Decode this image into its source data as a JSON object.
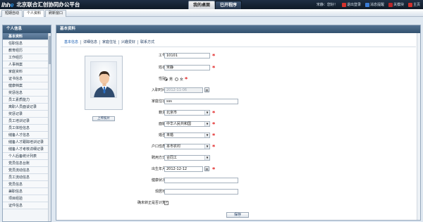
{
  "header": {
    "logo_text_1": "Ihh",
    "logo_text_2": "e",
    "title": "北京联合汇创协同办公平台",
    "tabs": [
      "我的桌面",
      "已开程序"
    ],
    "greeting": "宋静：您好！",
    "actions": [
      "退出登录",
      "消息提醒",
      "关模块",
      "主页"
    ]
  },
  "subtabs": [
    "短期自动",
    "个人资料",
    "刷新窗口"
  ],
  "sidebar": {
    "title": "个人信息",
    "items": [
      "基本资料",
      "任职信息",
      "教育经历",
      "工作经历",
      "人事档案",
      "家庭资料",
      "证书信息",
      "健康档案",
      "奖惩信息",
      "员工素质能力",
      "离职人员面谈记录",
      "奖惩记录",
      "员工培训记录",
      "员工体检信息",
      "储备人才信息",
      "储备人才跟踪培训记录",
      "储备人才考核详细记录",
      "个人后备统计列表",
      "党员信息台账",
      "党员流动信息",
      "员工流动信息",
      "党员信息",
      "兼职信息",
      "项目经验",
      "证件信息"
    ]
  },
  "main": {
    "title": "基本资料",
    "tabs": [
      "基本信息",
      "详细信息",
      "家庭住址",
      "兴趣爱好",
      "联系方式"
    ],
    "upload_label": "上传照片",
    "save_label": "保存",
    "fields": {
      "emp_no": {
        "label": "工号：",
        "value": "10101"
      },
      "name": {
        "label": "姓名：",
        "value": "宋静"
      },
      "gender": {
        "label": "性别：",
        "options": [
          "男",
          "女"
        ],
        "selected": "男"
      },
      "entry_date": {
        "label": "入职时间：",
        "value": "2012-11-06"
      },
      "home_address": {
        "label": "家庭住址：",
        "value": "sss"
      },
      "origin": {
        "label": "籍贯：",
        "value": "北京市"
      },
      "politics": {
        "label": "面貌：",
        "value": "中华人民共和国"
      },
      "marital": {
        "label": "婚否：",
        "value": "未婚"
      },
      "hukou": {
        "label": "户口性质：",
        "value": "本市农村"
      },
      "employment": {
        "label": "聘用方式：",
        "value": "合同工"
      },
      "birth": {
        "label": "出生年月：",
        "value": "2012-12-12"
      },
      "health": {
        "label": "健康状况：",
        "value": ""
      },
      "phone": {
        "label": "现居地：",
        "value": ""
      },
      "trial": {
        "label": "确未转正是否计算：",
        "checked": true,
        "check_mark": "✓"
      }
    }
  }
}
